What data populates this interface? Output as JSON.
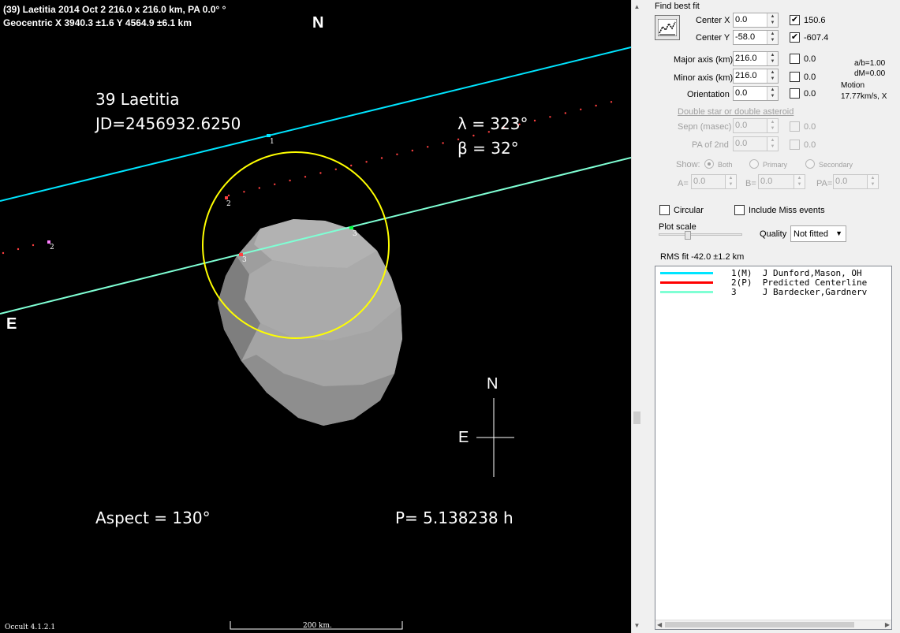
{
  "plot": {
    "header_line1": "(39) Laetitia  2014 Oct 2  216.0 x 216.0 km, PA 0.0° °",
    "header_line2": "Geocentric  X  3940.3 ±1.6  Y 4564.9 ±6.1 km",
    "north_top": "N",
    "east_left": "E",
    "asteroid_name": "39 Laetitia",
    "jd": "JD=2456932.6250",
    "lambda": "λ =  323°",
    "beta": "β =   32°",
    "aspect": "Aspect = 130°",
    "period": "P= 5.138238 h",
    "compass_n": "N",
    "compass_e": "E",
    "scale_label": "200 km.",
    "version": "Occult 4.1.2.1",
    "chord_labels": [
      "1",
      "2",
      "3",
      "3",
      "2"
    ],
    "colors": {
      "chord1": "#00e5ff",
      "chord3": "#7fffd4",
      "ellipse": "#ffff00",
      "predicted": "#ff4040",
      "shape": "#a0a0a0"
    }
  },
  "panel": {
    "find_best_fit": "Find best fit",
    "center_x_label": "Center X",
    "center_x_value": "0.0",
    "center_x_fit": "150.6",
    "center_y_label": "Center Y",
    "center_y_value": "-58.0",
    "center_y_fit": "-607.4",
    "major_label": "Major axis (km)",
    "major_value": "216.0",
    "major_fit": "0.0",
    "minor_label": "Minor axis (km)",
    "minor_value": "216.0",
    "minor_fit": "0.0",
    "orient_label": "Orientation",
    "orient_value": "0.0",
    "orient_fit": "0.0",
    "ab_ratio": "a/b=1.00",
    "dm": "dM=0.00",
    "motion": "Motion",
    "motion_value": "17.77km/s, X",
    "double_star": "Double star  or  double asteroid",
    "sepn_label": "Sepn (masec)",
    "sepn_value": "0.0",
    "sepn_fit": "0.0",
    "pa2_label": "PA of 2nd",
    "pa2_value": "0.0",
    "pa2_fit": "0.0",
    "show_label": "Show:",
    "show_both": "Both",
    "show_primary": "Primary",
    "show_secondary": "Secondary",
    "a_label": "A=",
    "a_value": "0.0",
    "b_label": "B=",
    "b_value": "0.0",
    "pa_label": "PA=",
    "pa_value": "0.0",
    "circular": "Circular",
    "include_miss": "Include Miss events",
    "plot_scale": "Plot scale",
    "quality_label": "Quality",
    "quality_value": "Not fitted",
    "rms_fit": "RMS fit -42.0 ±1.2 km",
    "observers": [
      {
        "text": "1(M)  J Dunford,Mason, OH",
        "color": "#00e5ff"
      },
      {
        "text": "2(P)  Predicted Centerline",
        "color": "#ff0000"
      },
      {
        "text": "3     J Bardecker,Gardnerv",
        "color": "#7fffd4"
      }
    ]
  }
}
